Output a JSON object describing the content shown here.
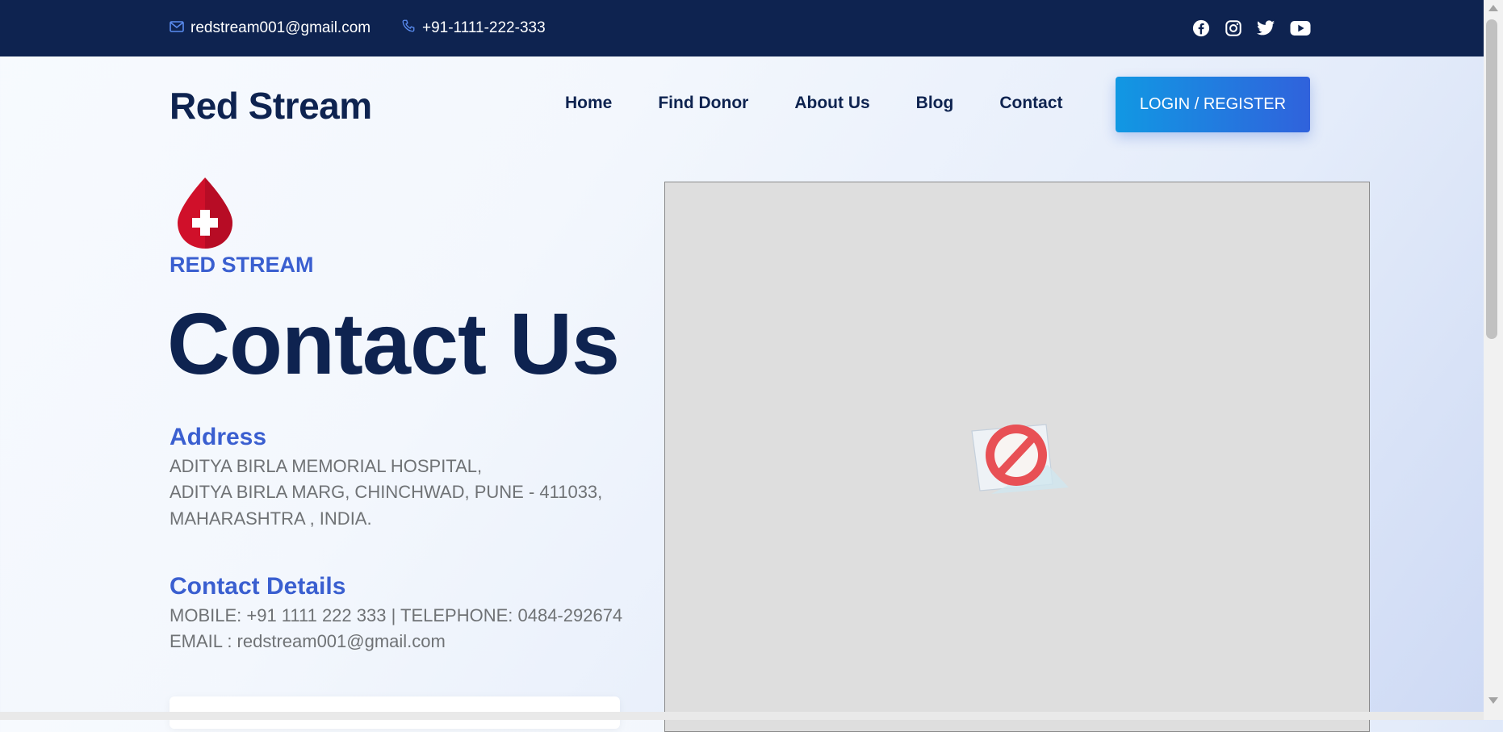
{
  "topbar": {
    "email": "redstream001@gmail.com",
    "phone": "+91-1111-222-333",
    "icons": [
      "mail-icon",
      "phone-icon"
    ],
    "socials": [
      "facebook-icon",
      "instagram-icon",
      "twitter-icon",
      "youtube-icon"
    ],
    "background": "#0e2350"
  },
  "navbar": {
    "brand": "Red Stream",
    "links": [
      "Home",
      "Find Donor",
      "About Us",
      "Blog",
      "Contact"
    ],
    "login_label": "LOGIN / REGISTER"
  },
  "hero": {
    "logo_text": "RED STREAM",
    "logo_icon": "blood-drop-cross-icon",
    "heading": "Contact Us"
  },
  "address": {
    "title": "Address",
    "lines": [
      "ADITYA BIRLA MEMORIAL HOSPITAL,",
      "ADITYA BIRLA MARG, CHINCHWAD, PUNE - 411033,",
      "MAHARASHTRA , INDIA."
    ]
  },
  "contact": {
    "title": "Contact Details",
    "lines": [
      "MOBILE: +91 1111 222 333 | TELEPHONE: 0484-292674",
      "EMAIL : redstream001@gmail.com"
    ]
  },
  "map": {
    "state": "blocked",
    "icon": "blocked-content-icon"
  },
  "colors": {
    "navy": "#0e2350",
    "accent_blue": "#3a5fd0",
    "blood_red": "#d0102a",
    "button_gradient": [
      "#1198e3",
      "#3062dc"
    ]
  }
}
